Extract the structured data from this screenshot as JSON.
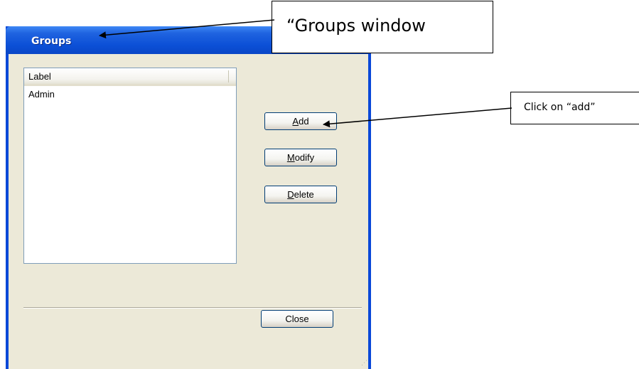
{
  "window": {
    "title": "Groups"
  },
  "listview": {
    "column_header": "Label",
    "rows": [
      "Admin"
    ]
  },
  "buttons": {
    "add": {
      "mnemonic": "A",
      "rest": "dd"
    },
    "modify": {
      "mnemonic": "M",
      "rest": "odify"
    },
    "delete": {
      "mnemonic": "D",
      "rest": "elete"
    },
    "close": "Close"
  },
  "annotations": {
    "window_callout": "“Groups window",
    "add_callout": "Click on “add”"
  },
  "colors": {
    "titlebar": "#0b4fd6",
    "client": "#ece9d8",
    "button_border": "#003c74"
  }
}
